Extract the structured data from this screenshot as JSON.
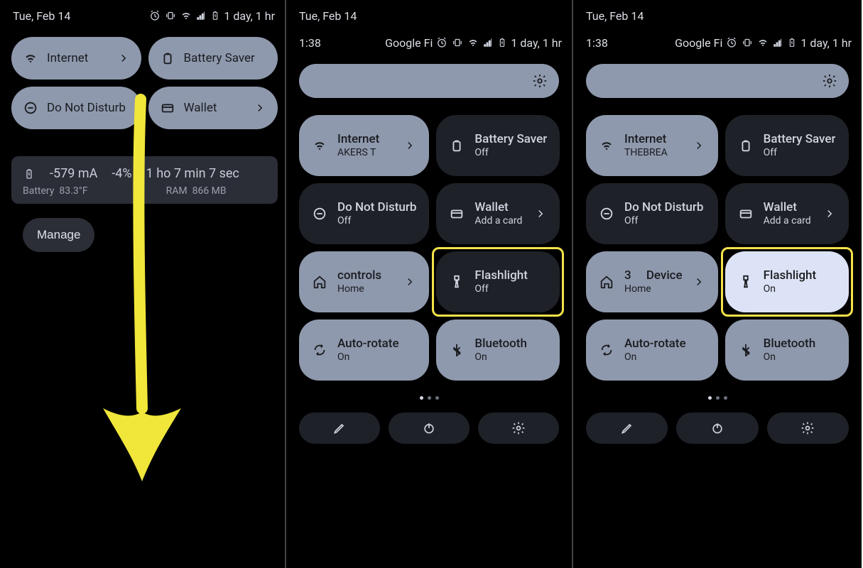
{
  "status": {
    "date": "Tue, Feb 14",
    "time_remaining": "1 day, 1 hr"
  },
  "substatus": {
    "time": "1:38",
    "carrier": "Google Fi",
    "time_remaining": "1 day, 1 hr"
  },
  "panel0": {
    "tiles": {
      "internet": "Internet",
      "battery_saver": "Battery Saver",
      "dnd": "Do Not Disturb",
      "wallet": "Wallet"
    },
    "bat": {
      "current": "-579 mA",
      "pct": "-4%",
      "time": "1 ho   7 min 7 sec",
      "battery_label": "Battery",
      "battery_temp": "83.3°F",
      "ram_label": "RAM",
      "ram_val": "866 MB"
    },
    "manage": "Manage"
  },
  "panel1": {
    "internet": {
      "title": "Internet",
      "sub": "AKERS    T"
    },
    "battery_saver": {
      "title": "Battery Saver",
      "sub": "Off"
    },
    "dnd": {
      "title": "Do Not Disturb",
      "sub": "Off"
    },
    "wallet": {
      "title": "Wallet",
      "sub": "Add a card"
    },
    "controls": {
      "title": "controls",
      "sub": "Home"
    },
    "flashlight": {
      "title": "Flashlight",
      "sub": "Off"
    },
    "autorotate": {
      "title": "Auto-rotate",
      "sub": "On"
    },
    "bluetooth": {
      "title": "Bluetooth",
      "sub": "On"
    }
  },
  "panel2": {
    "internet": {
      "title": "Internet",
      "sub": "THEBREA"
    },
    "battery_saver": {
      "title": "Battery Saver",
      "sub": "Off"
    },
    "dnd": {
      "title": "Do Not Disturb",
      "sub": "Off"
    },
    "wallet": {
      "title": "Wallet",
      "sub": "Add a card"
    },
    "controls": {
      "title": "Device",
      "sub": "Home",
      "prefix": "3"
    },
    "flashlight": {
      "title": "Flashlight",
      "sub": "On"
    },
    "autorotate": {
      "title": "Auto-rotate",
      "sub": "On"
    },
    "bluetooth": {
      "title": "Bluetooth",
      "sub": "On"
    }
  }
}
